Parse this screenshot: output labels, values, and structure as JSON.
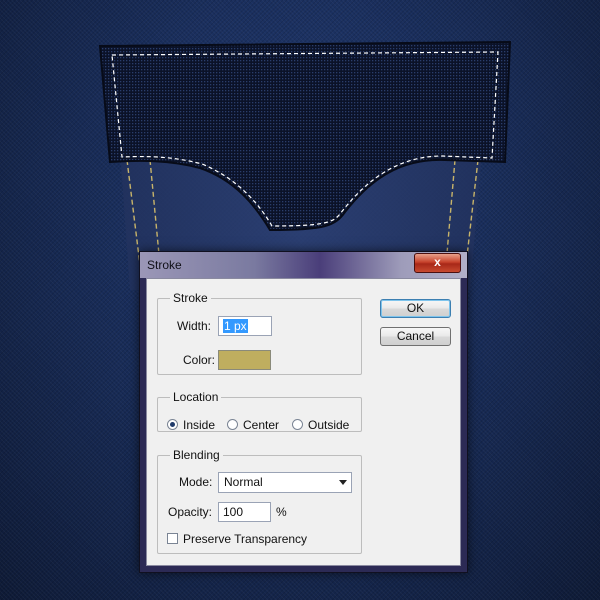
{
  "dialog": {
    "title": "Stroke",
    "close_label": "x",
    "stroke_group": {
      "legend": "Stroke",
      "width_label": "Width:",
      "width_value": "1 px",
      "color_label": "Color:",
      "color_value": "#bfae5f"
    },
    "location_group": {
      "legend": "Location",
      "options": [
        "Inside",
        "Center",
        "Outside"
      ],
      "selected": "Inside"
    },
    "blending_group": {
      "legend": "Blending",
      "mode_label": "Mode:",
      "mode_value": "Normal",
      "opacity_label": "Opacity:",
      "opacity_value": "100",
      "opacity_unit": "%",
      "preserve_label": "Preserve Transparency",
      "preserve_checked": false
    },
    "buttons": {
      "ok": "OK",
      "cancel": "Cancel"
    }
  },
  "canvas": {
    "background_color": "#1a2f5e",
    "stitch_color": "#c8b46a",
    "selection_marquee": "dashed white"
  }
}
